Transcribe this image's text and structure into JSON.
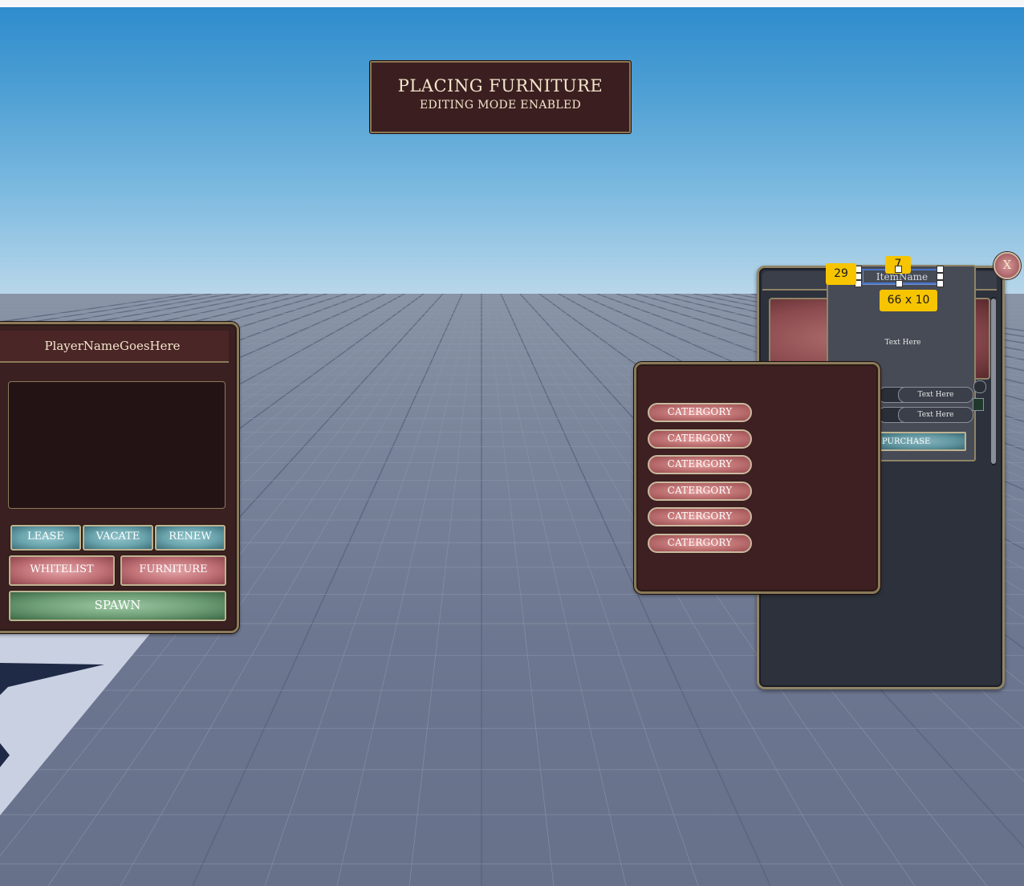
{
  "banner": {
    "title": "PLACING FURNITURE",
    "subtitle": "EDITING MODE ENABLED"
  },
  "player_panel": {
    "name": "PlayerNameGoesHere",
    "buttons": {
      "lease": "LEASE",
      "vacate": "VACATE",
      "renew": "RENEW",
      "whitelist": "WHITELIST",
      "furniture": "FURNITURE",
      "spawn": "SPAWN"
    }
  },
  "category_panel": {
    "categories": [
      "CATERGORY",
      "CATERGORY",
      "CATERGORY",
      "CATERGORY",
      "CATERGORY",
      "CATERGORY"
    ]
  },
  "shop_panel": {
    "close_label": "X",
    "item_name": "ItemName",
    "description": "Text Here",
    "stat1": "Text Here",
    "stat2": "Text Here",
    "purchase_label": "PURCHASE"
  },
  "studio_overlay": {
    "offset_x": "29",
    "offset_y": "7",
    "size": "66 x 10"
  },
  "colors": {
    "panel_maroon": "#3a2020",
    "panel_slate": "#2c313c",
    "frame_gold": "#8a7a5a",
    "accent_yellow": "#f7c400"
  }
}
